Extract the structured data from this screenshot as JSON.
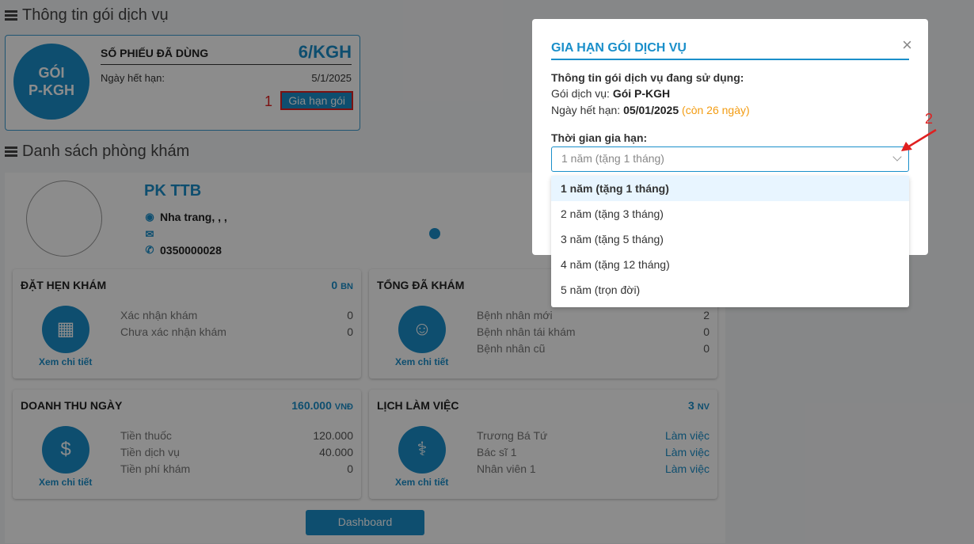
{
  "service_section": {
    "title": "Thông tin gói dịch vụ"
  },
  "package": {
    "name_line1": "GÓI",
    "name_line2": "P-KGH",
    "used_label": "SỐ PHIẾU ĐÃ DÙNG",
    "used_value": "6/KGH",
    "expiry_label": "Ngày hết hạn:",
    "expiry_value": "5/1/2025",
    "renew_button": "Gia hạn gói",
    "annotation": "1"
  },
  "clinic_section": {
    "title": "Danh sách phòng khám"
  },
  "clinic": {
    "name": "PK TTB",
    "address": "Nha trang, , ,",
    "email": "",
    "phone": "0350000028"
  },
  "stats": {
    "appointments": {
      "title": "ĐẶT HẸN KHÁM",
      "value": "0",
      "unit": "BN",
      "link": "Xem chi tiết",
      "rows": [
        {
          "label": "Xác nhận khám",
          "value": "0"
        },
        {
          "label": "Chưa xác nhận khám",
          "value": "0"
        }
      ]
    },
    "total_exams": {
      "title": "TỔNG ĐÃ KHÁM",
      "value": "",
      "unit": "",
      "link": "Xem chi tiết",
      "rows": [
        {
          "label": "Bệnh nhân mới",
          "value": "2"
        },
        {
          "label": "Bệnh nhân tái khám",
          "value": "0"
        },
        {
          "label": "Bệnh nhân cũ",
          "value": "0"
        }
      ]
    },
    "daily_revenue": {
      "title": "DOANH THU NGÀY",
      "value": "160.000",
      "unit": "VNĐ",
      "link": "Xem chi tiết",
      "rows": [
        {
          "label": "Tiền thuốc",
          "value": "120.000"
        },
        {
          "label": "Tiền dịch vụ",
          "value": "40.000"
        },
        {
          "label": "Tiền phí khám",
          "value": "0"
        }
      ]
    },
    "schedule": {
      "title": "LỊCH LÀM VIỆC",
      "value": "3",
      "unit": "NV",
      "link": "Xem chi tiết",
      "rows": [
        {
          "label": "Trương Bá Tứ",
          "value": "Làm việc"
        },
        {
          "label": "Bác sĩ 1",
          "value": "Làm việc"
        },
        {
          "label": "Nhân viên 1",
          "value": "Làm việc"
        }
      ]
    }
  },
  "dashboard_button": "Dashboard",
  "modal": {
    "title": "GIA HẠN GÓI DỊCH VỤ",
    "close": "×",
    "info_heading": "Thông tin gói dịch vụ đang sử dụng:",
    "pkg_label": "Gói dịch vụ: ",
    "pkg_value": "Gói P-KGH",
    "exp_label": "Ngày hết hạn: ",
    "exp_value": "05/01/2025",
    "remaining": "(còn 26 ngày)",
    "duration_label": "Thời gian gia hạn:",
    "select_value": "1 năm (tặng 1 tháng)",
    "options": [
      "1 năm (tặng 1 tháng)",
      "2 năm (tặng 3 tháng)",
      "3 năm (tặng 5 tháng)",
      "4 năm (tặng 12 tháng)",
      "5 năm (trọn đời)"
    ],
    "annotation": "2"
  },
  "colors": {
    "primary": "#1a8fca",
    "annotation": "#e02020",
    "highlight": "#f39c12"
  }
}
